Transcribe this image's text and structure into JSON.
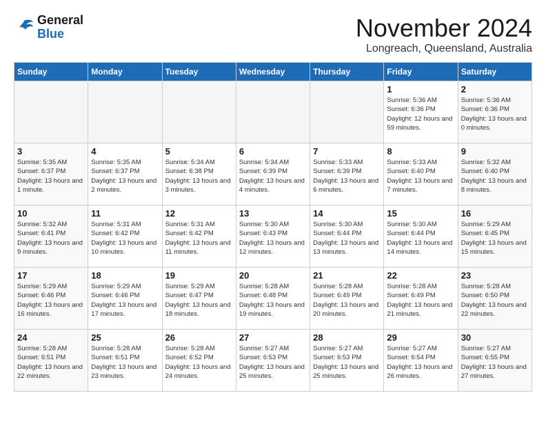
{
  "header": {
    "logo": {
      "line1": "General",
      "line2": "Blue"
    },
    "title": "November 2024",
    "location": "Longreach, Queensland, Australia"
  },
  "weekdays": [
    "Sunday",
    "Monday",
    "Tuesday",
    "Wednesday",
    "Thursday",
    "Friday",
    "Saturday"
  ],
  "weeks": [
    [
      {
        "day": "",
        "info": ""
      },
      {
        "day": "",
        "info": ""
      },
      {
        "day": "",
        "info": ""
      },
      {
        "day": "",
        "info": ""
      },
      {
        "day": "",
        "info": ""
      },
      {
        "day": "1",
        "info": "Sunrise: 5:36 AM\nSunset: 6:36 PM\nDaylight: 12 hours\nand 59 minutes."
      },
      {
        "day": "2",
        "info": "Sunrise: 5:36 AM\nSunset: 6:36 PM\nDaylight: 13 hours\nand 0 minutes."
      }
    ],
    [
      {
        "day": "3",
        "info": "Sunrise: 5:35 AM\nSunset: 6:37 PM\nDaylight: 13 hours\nand 1 minute."
      },
      {
        "day": "4",
        "info": "Sunrise: 5:35 AM\nSunset: 6:37 PM\nDaylight: 13 hours\nand 2 minutes."
      },
      {
        "day": "5",
        "info": "Sunrise: 5:34 AM\nSunset: 6:38 PM\nDaylight: 13 hours\nand 3 minutes."
      },
      {
        "day": "6",
        "info": "Sunrise: 5:34 AM\nSunset: 6:39 PM\nDaylight: 13 hours\nand 4 minutes."
      },
      {
        "day": "7",
        "info": "Sunrise: 5:33 AM\nSunset: 6:39 PM\nDaylight: 13 hours\nand 6 minutes."
      },
      {
        "day": "8",
        "info": "Sunrise: 5:33 AM\nSunset: 6:40 PM\nDaylight: 13 hours\nand 7 minutes."
      },
      {
        "day": "9",
        "info": "Sunrise: 5:32 AM\nSunset: 6:40 PM\nDaylight: 13 hours\nand 8 minutes."
      }
    ],
    [
      {
        "day": "10",
        "info": "Sunrise: 5:32 AM\nSunset: 6:41 PM\nDaylight: 13 hours\nand 9 minutes."
      },
      {
        "day": "11",
        "info": "Sunrise: 5:31 AM\nSunset: 6:42 PM\nDaylight: 13 hours\nand 10 minutes."
      },
      {
        "day": "12",
        "info": "Sunrise: 5:31 AM\nSunset: 6:42 PM\nDaylight: 13 hours\nand 11 minutes."
      },
      {
        "day": "13",
        "info": "Sunrise: 5:30 AM\nSunset: 6:43 PM\nDaylight: 13 hours\nand 12 minutes."
      },
      {
        "day": "14",
        "info": "Sunrise: 5:30 AM\nSunset: 6:44 PM\nDaylight: 13 hours\nand 13 minutes."
      },
      {
        "day": "15",
        "info": "Sunrise: 5:30 AM\nSunset: 6:44 PM\nDaylight: 13 hours\nand 14 minutes."
      },
      {
        "day": "16",
        "info": "Sunrise: 5:29 AM\nSunset: 6:45 PM\nDaylight: 13 hours\nand 15 minutes."
      }
    ],
    [
      {
        "day": "17",
        "info": "Sunrise: 5:29 AM\nSunset: 6:46 PM\nDaylight: 13 hours\nand 16 minutes."
      },
      {
        "day": "18",
        "info": "Sunrise: 5:29 AM\nSunset: 6:46 PM\nDaylight: 13 hours\nand 17 minutes."
      },
      {
        "day": "19",
        "info": "Sunrise: 5:29 AM\nSunset: 6:47 PM\nDaylight: 13 hours\nand 18 minutes."
      },
      {
        "day": "20",
        "info": "Sunrise: 5:28 AM\nSunset: 6:48 PM\nDaylight: 13 hours\nand 19 minutes."
      },
      {
        "day": "21",
        "info": "Sunrise: 5:28 AM\nSunset: 6:49 PM\nDaylight: 13 hours\nand 20 minutes."
      },
      {
        "day": "22",
        "info": "Sunrise: 5:28 AM\nSunset: 6:49 PM\nDaylight: 13 hours\nand 21 minutes."
      },
      {
        "day": "23",
        "info": "Sunrise: 5:28 AM\nSunset: 6:50 PM\nDaylight: 13 hours\nand 22 minutes."
      }
    ],
    [
      {
        "day": "24",
        "info": "Sunrise: 5:28 AM\nSunset: 6:51 PM\nDaylight: 13 hours\nand 22 minutes."
      },
      {
        "day": "25",
        "info": "Sunrise: 5:28 AM\nSunset: 6:51 PM\nDaylight: 13 hours\nand 23 minutes."
      },
      {
        "day": "26",
        "info": "Sunrise: 5:28 AM\nSunset: 6:52 PM\nDaylight: 13 hours\nand 24 minutes."
      },
      {
        "day": "27",
        "info": "Sunrise: 5:27 AM\nSunset: 6:53 PM\nDaylight: 13 hours\nand 25 minutes."
      },
      {
        "day": "28",
        "info": "Sunrise: 5:27 AM\nSunset: 6:53 PM\nDaylight: 13 hours\nand 25 minutes."
      },
      {
        "day": "29",
        "info": "Sunrise: 5:27 AM\nSunset: 6:54 PM\nDaylight: 13 hours\nand 26 minutes."
      },
      {
        "day": "30",
        "info": "Sunrise: 5:27 AM\nSunset: 6:55 PM\nDaylight: 13 hours\nand 27 minutes."
      }
    ]
  ]
}
